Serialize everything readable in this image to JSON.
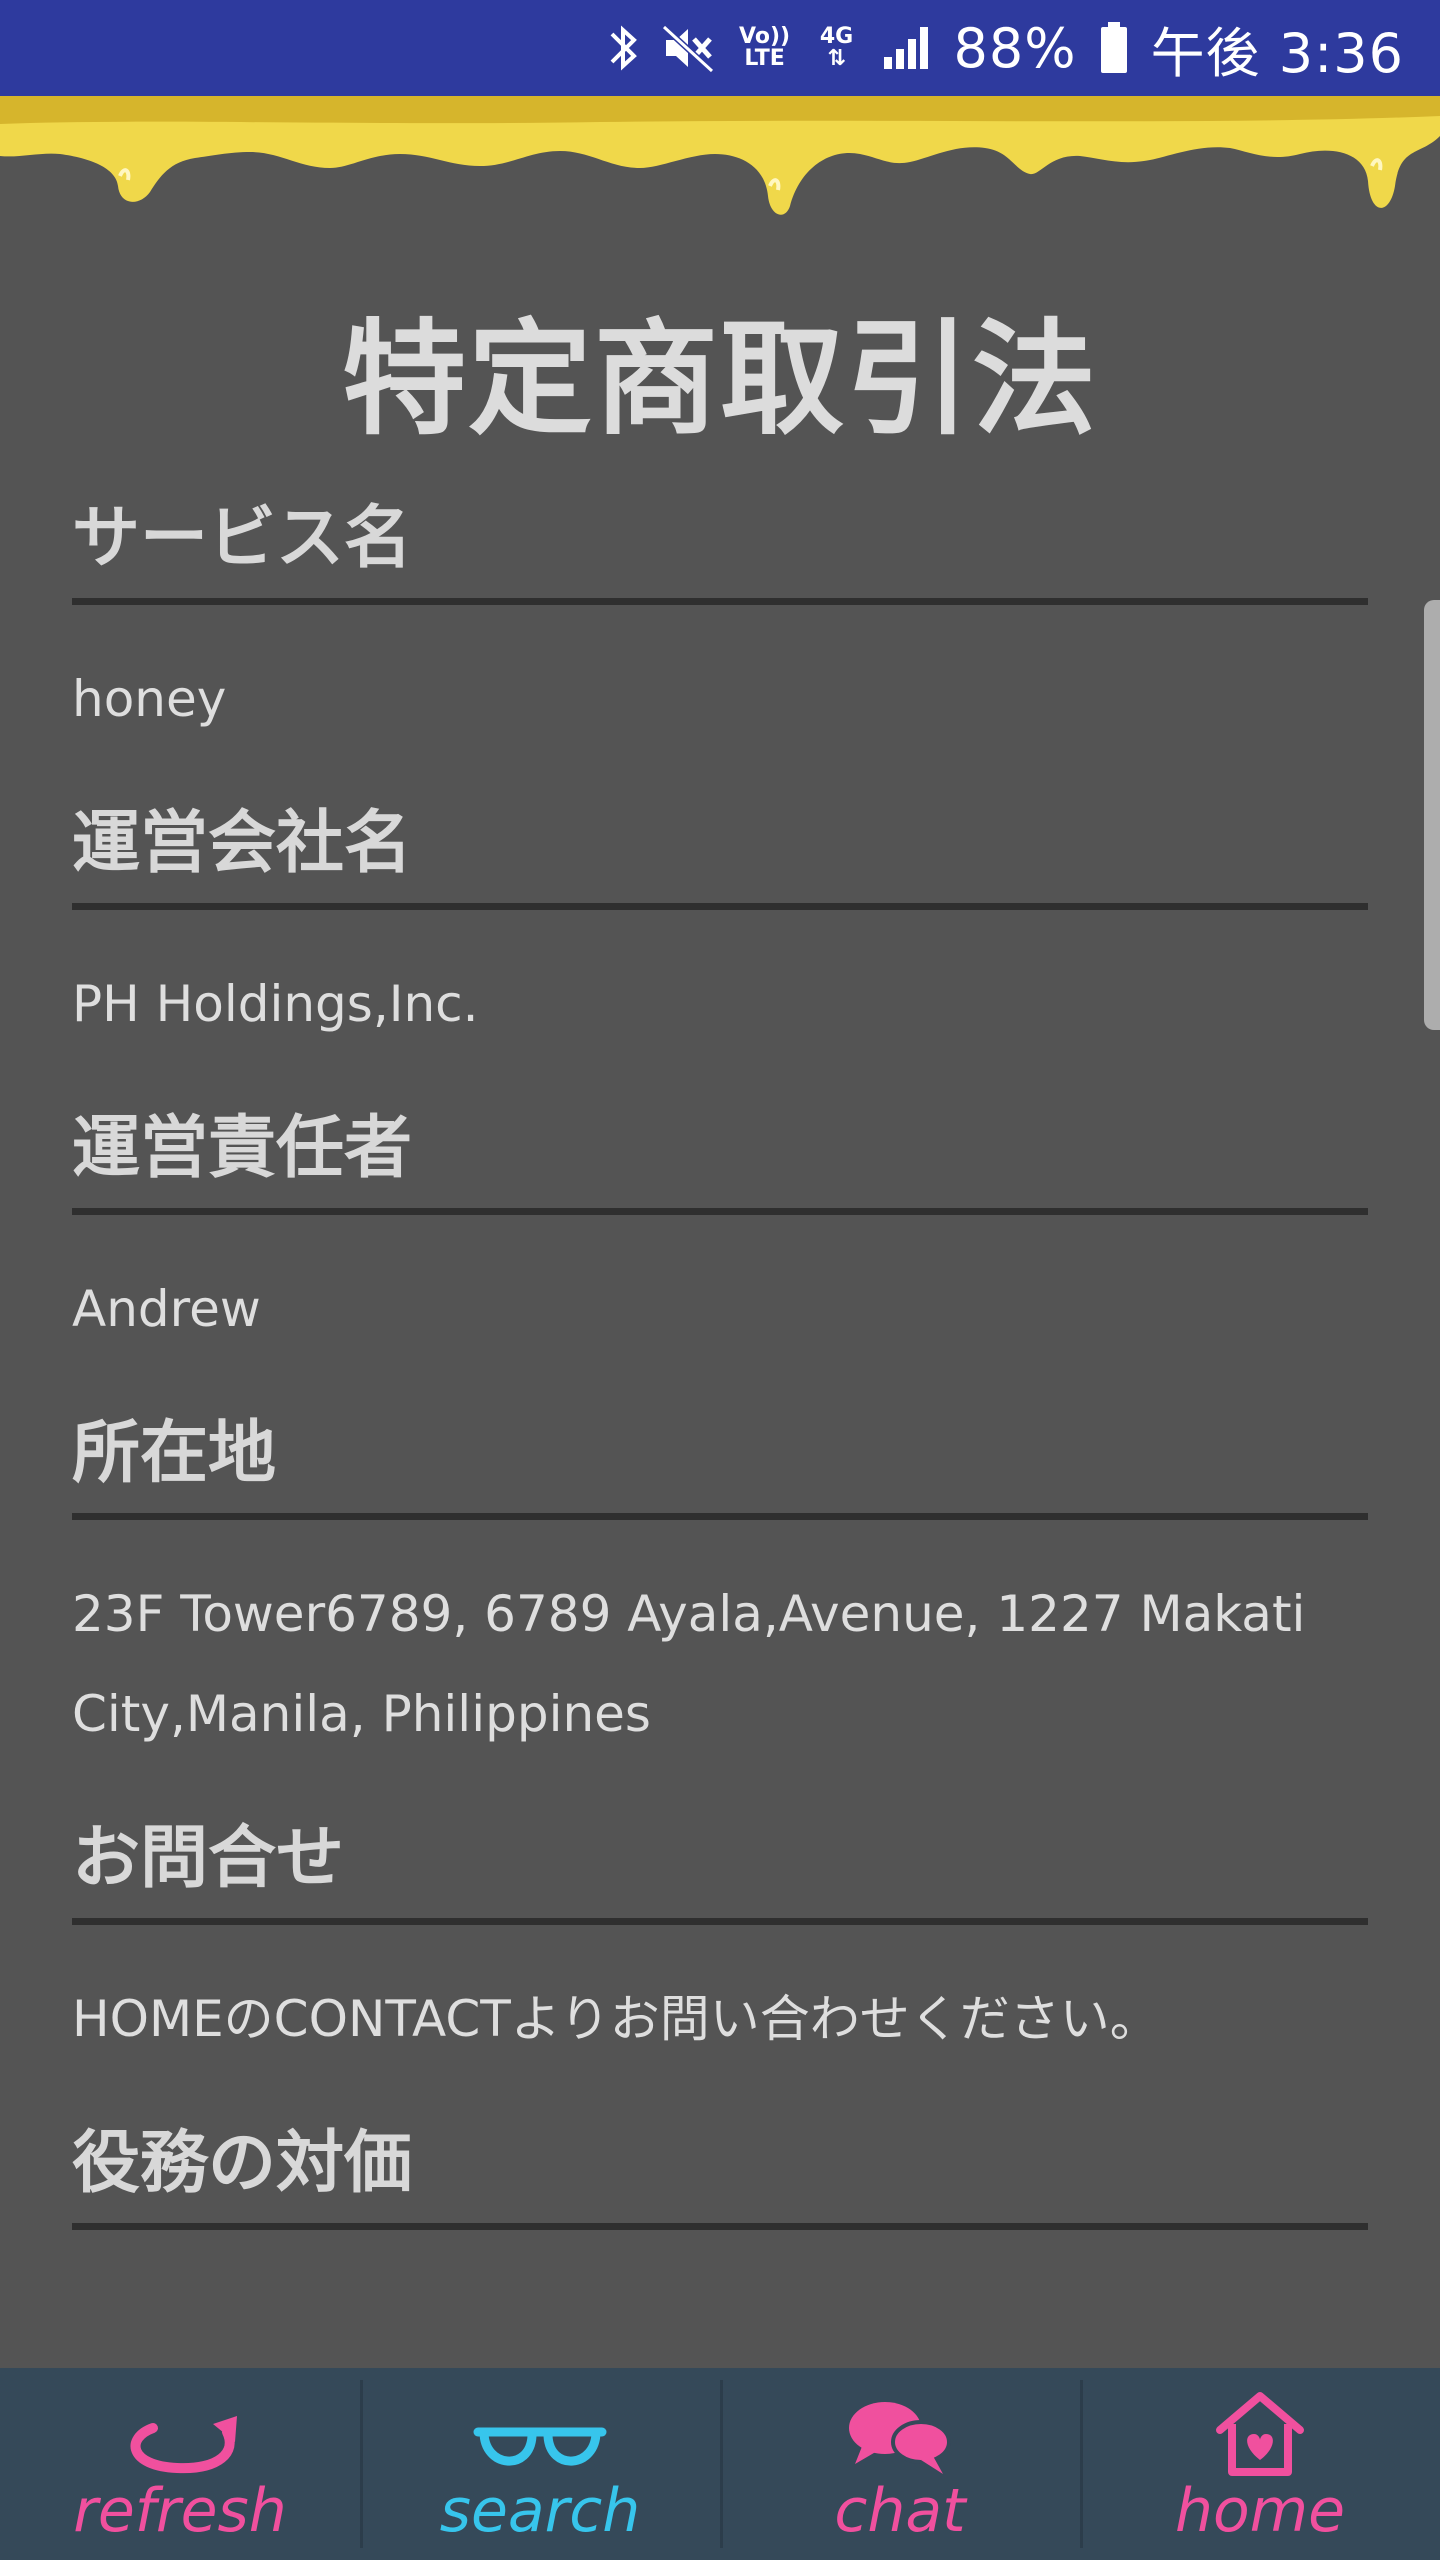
{
  "status_bar": {
    "battery_percent": "88%",
    "time": "午後 3:36",
    "volte_label": "Vo)) LTE",
    "network_label": "4G"
  },
  "page": {
    "title": "特定商取引法"
  },
  "sections": [
    {
      "heading": "サービス名",
      "value": "honey"
    },
    {
      "heading": "運営会社名",
      "value": "PH Holdings,Inc."
    },
    {
      "heading": "運営責任者",
      "value": "Andrew"
    },
    {
      "heading": "所在地",
      "value": "23F Tower6789, 6789 Ayala,Avenue, 1227 Makati City,Manila, Philippines"
    },
    {
      "heading": "お問合せ",
      "value": "HOMEのCONTACTよりお問い合わせください。"
    },
    {
      "heading": "役務の対価",
      "value": ""
    }
  ],
  "bottom_nav": {
    "items": [
      {
        "label": "refresh",
        "icon": "refresh-icon",
        "color": "#f0509e"
      },
      {
        "label": "search",
        "icon": "glasses-icon",
        "color": "#37c5ec"
      },
      {
        "label": "chat",
        "icon": "chat-bubbles-icon",
        "color": "#f0509e"
      },
      {
        "label": "home",
        "icon": "home-heart-icon",
        "color": "#f0509e"
      }
    ]
  },
  "colors": {
    "status_bar": "#2e3a9e",
    "background": "#545454",
    "honey": "#f2dc4a",
    "nav_background": "#354959"
  }
}
